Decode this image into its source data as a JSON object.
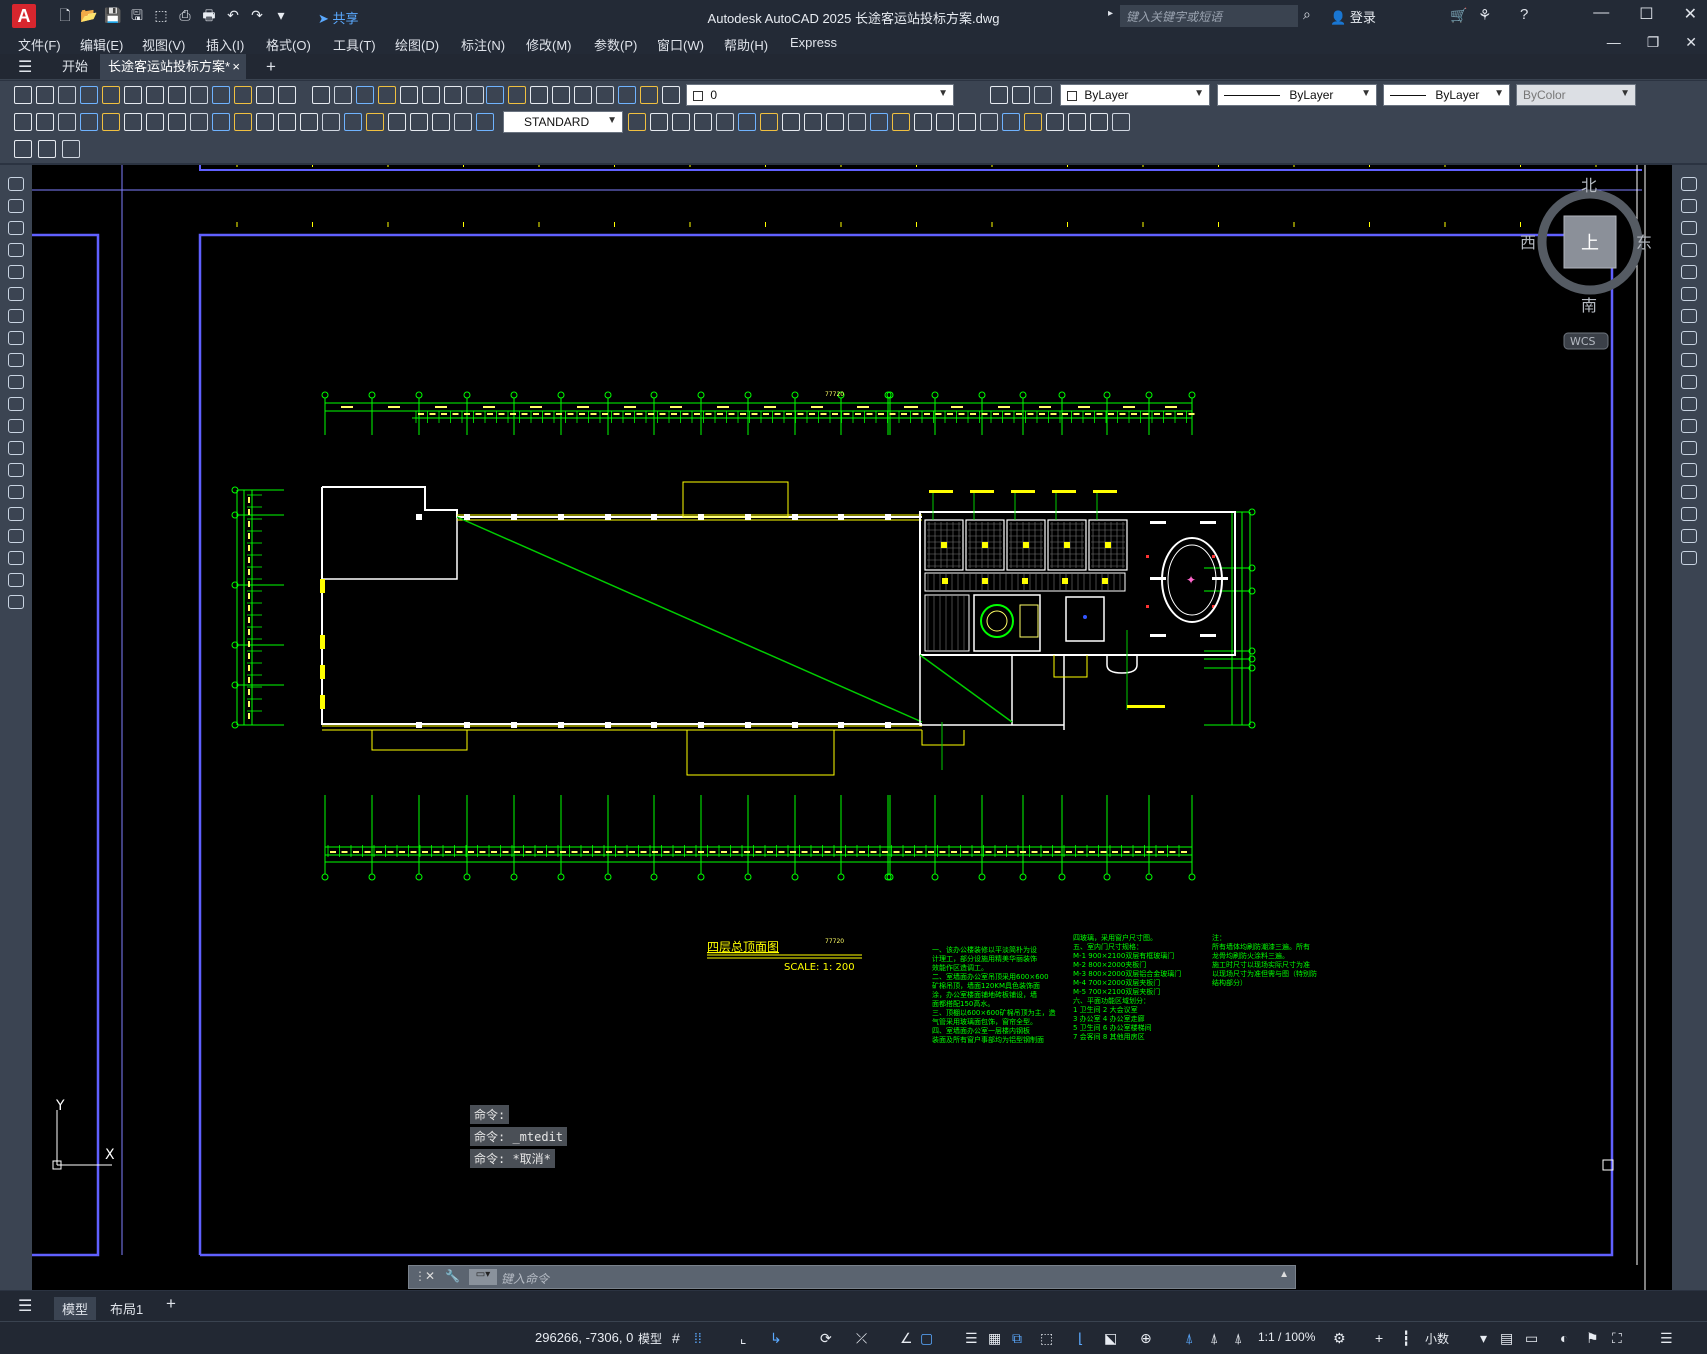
{
  "titlebar": {
    "app_letter": "A",
    "share_label": "共享",
    "title": "Autodesk AutoCAD 2025    长途客运站投标方案.dwg",
    "search_placeholder": "键入关键字或短语",
    "login_label": "登录"
  },
  "menu": {
    "items": [
      "文件(F)",
      "编辑(E)",
      "视图(V)",
      "插入(I)",
      "格式(O)",
      "工具(T)",
      "绘图(D)",
      "标注(N)",
      "修改(M)",
      "参数(P)",
      "窗口(W)",
      "帮助(H)",
      "Express"
    ]
  },
  "tabs": {
    "start": "开始",
    "document": "长途客运站投标方案*",
    "close": "×",
    "add": "+"
  },
  "toolbar": {
    "layer_name": "0",
    "color_value": "ByLayer",
    "linetype_value": "ByLayer",
    "lineweight_value": "ByLayer",
    "plotstyle_value": "ByColor",
    "textstyle_value": "STANDARD"
  },
  "viewcube": {
    "north": "北",
    "south": "南",
    "east": "东",
    "west": "西",
    "top": "上",
    "wcs": "WCS"
  },
  "ucs": {
    "y_label": "Y",
    "x_label": "X"
  },
  "drawing": {
    "title": "四层总顶面图",
    "scale": "SCALE: 1: 200",
    "total_dim_top": "77720",
    "total_dim_bottom": "77720",
    "notes_left": [
      "一、该办公楼装修以平淡简朴为设",
      "计理工，部分设施用精美华丽装饰",
      "效能作区造调工。",
      "二、室墙面办公室吊顶采用600×600",
      "矿棉吊顶，墙面120KM具色装饰面",
      "涂，办公室楼面铺地砖板铺设，墙",
      "面都搭配150高水。",
      "三、顶棚以600×600矿棉吊顶为主，造",
      "气管采用玻璃面包饰，窗帘全型。",
      "四、室墙面办公室一层楼内钢板",
      "装面及所有窗户事部均为铝型钢制面"
    ],
    "notes_mid": [
      "四玻璃，采用窗户尺寸图。",
      "五、室内门尺寸规格：",
      "  M-1  900×2100双层有框玻璃门",
      "  M-2  800×2000夹板门",
      "  M-3  800×2000双层铝合金玻璃门",
      "  M-4  700×2000双层夹板门",
      "  M-5  700×2100双层夹板门",
      "六、平面功能区域划分：",
      "  1 卫生间    2 大会议室",
      "  3 办公室    4 办公室走廊",
      "  5 卫生间    6 办公室楼梯间",
      "  7 会客间    8 其他用房区"
    ],
    "notes_right": [
      "注：",
      "  所有墙体均刷防潮漆三遍。所有",
      "龙骨均刷防火涂料三遍。",
      "  施工时尺寸以现场实际尺寸为准",
      "以现场尺寸为准但需与图（特别防",
      "结构部分）"
    ]
  },
  "command": {
    "history": [
      "命令:",
      "命令: _mtedit",
      "命令: *取消*"
    ],
    "prompt": "键入命令"
  },
  "layout_tabs": {
    "model": "模型",
    "layout1": "布局1",
    "add": "+"
  },
  "status": {
    "coords": "296266, -7306, 0",
    "space": "模型",
    "scale": "1:1 / 100%",
    "units": "小数"
  }
}
